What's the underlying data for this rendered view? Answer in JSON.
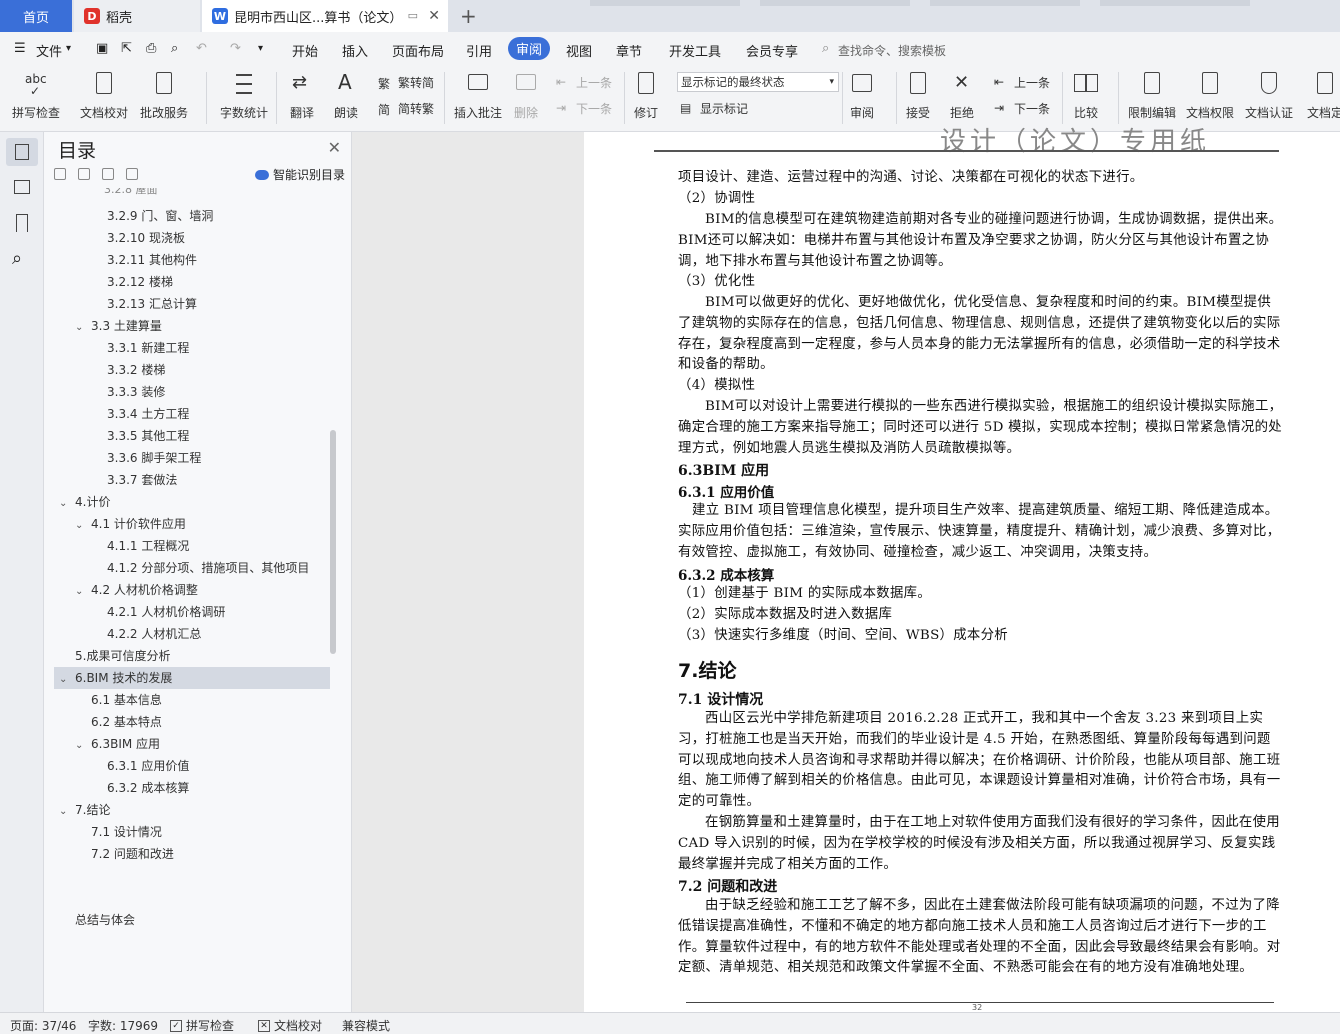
{
  "tabs": {
    "home": "首页",
    "daoke": "稻壳",
    "doc": "昆明市西山区...算书（论文）"
  },
  "menu": {
    "file": "文件",
    "items": [
      "开始",
      "插入",
      "页面布局",
      "引用",
      "审阅",
      "视图",
      "章节",
      "开发工具",
      "会员专享"
    ],
    "search": "查找命令、搜索模板"
  },
  "ribbon": {
    "spell": "拼写检查",
    "doccheck": "文档校对",
    "batch": "批改服务",
    "wordcount": "字数统计",
    "translate": "翻译",
    "read": "朗读",
    "trad": "繁转简",
    "simp": "简转繁",
    "insert_comment": "插入批注",
    "delete": "删除",
    "prev_comment": "上一条",
    "next_comment": "下一条",
    "track": "修订",
    "markup_state": "显示标记的最终状态",
    "show_markup": "显示标记",
    "review": "审阅",
    "accept": "接受",
    "reject": "拒绝",
    "prev": "上一条",
    "next": "下一条",
    "compare": "比较",
    "restrict": "限制编辑",
    "perm": "文档权限",
    "certify": "文档认证",
    "finalize": "文档定"
  },
  "toc": {
    "title": "目录",
    "smart": "智能识别目录",
    "items": [
      "3.2.9 门、窗、墙洞",
      "3.2.10 现浇板",
      "3.2.11 其他构件",
      "3.2.12 楼梯",
      "3.2.13 汇总计算",
      "3.3 土建算量",
      "3.3.1 新建工程",
      "3.3.2 楼梯",
      "3.3.3 装修",
      "3.3.4 土方工程",
      "3.3.5 其他工程",
      "3.3.6 脚手架工程",
      "3.3.7 套做法",
      "4.计价",
      "4.1 计价软件应用",
      "4.1.1 工程概况",
      "4.1.2 分部分项、措施项目、其他项目",
      "4.2 人材机价格调整",
      "4.2.1 人材机价格调研",
      "4.2.2 人材机汇总",
      "5.成果可信度分析",
      "6.BIM 技术的发展",
      "6.1 基本信息",
      "6.2 基本特点",
      "6.3BIM 应用",
      "6.3.1 应用价值",
      "6.3.2 成本核算",
      "7.结论",
      "7.1 设计情况",
      "7.2 问题和改进",
      "总结与体会"
    ]
  },
  "doc": {
    "header": "设计（论文）专用纸",
    "p1": "项目设计、建造、运营过程中的沟通、讨论、决策都在可视化的状态下进行。",
    "h_coord": "（2）协调性",
    "p2": "BIM的信息模型可在建筑物建造前期对各专业的碰撞问题进行协调，生成协调数据，提供出来。BIM还可以解决如：电梯井布置与其他设计布置及净空要求之协调，防火分区与其他设计布置之协调，地下排水布置与其他设计布置之协调等。",
    "h_opt": "（3）优化性",
    "p3": "BIM可以做更好的优化、更好地做优化，优化受信息、复杂程度和时间的约束。BIM模型提供了建筑物的实际存在的信息，包括几何信息、物理信息、规则信息，还提供了建筑物变化以后的实际存在，复杂程度高到一定程度，参与人员本身的能力无法掌握所有的信息，必须借助一定的科学技术和设备的帮助。",
    "h_sim": "（4）模拟性",
    "p4": "BIM可以对设计上需要进行模拟的一些东西进行模拟实验，根据施工的组织设计模拟实际施工，确定合理的施工方案来指导施工；同时还可以进行 5D 模拟，实现成本控制；模拟日常紧急情况的处理方式，例如地震人员逃生模拟及消防人员疏散模拟等。",
    "h63": "6.3BIM 应用",
    "h631": "6.3.1 应用价值",
    "p5": "建立 BIM 项目管理信息化模型，提升项目生产效率、提高建筑质量、缩短工期、降低建造成本。实际应用价值包括：三维渲染，宣传展示、快速算量，精度提升、精确计划，减少浪费、多算对比，有效管控、虚拟施工，有效协同、碰撞检查，减少返工、冲突调用，决策支持。",
    "h632": "6.3.2 成本核算",
    "l1": "（1）创建基于 BIM 的实际成本数据库。",
    "l2": "（2）实际成本数据及时进入数据库",
    "l3": "（3）快速实行多维度（时间、空间、WBS）成本分析",
    "h7": "7.结论",
    "h71": "7.1 设计情况",
    "p6": "西山区云光中学排危新建项目 2016.2.28 正式开工，我和其中一个舍友 3.23 来到项目上实习，打桩施工也是当天开始，而我们的毕业设计是 4.5 开始，在熟悉图纸、算量阶段每每遇到问题可以现成地向技术人员咨询和寻求帮助并得以解决；在价格调研、计价阶段，也能从项目部、施工班组、施工师傅了解到相关的价格信息。由此可见，本课题设计算量相对准确，计价符合市场，具有一定的可靠性。",
    "p7": "在钢筋算量和土建算量时，由于在工地上对软件使用方面我们没有很好的学习条件，因此在使用 CAD 导入识别的时候，因为在学校学校的时候没有涉及相关方面，所以我通过视屏学习、反复实践最终掌握并完成了相关方面的工作。",
    "h72": "7.2 问题和改进",
    "p8": "由于缺乏经验和施工工艺了解不多，因此在土建套做法阶段可能有缺项漏项的问题，不过为了降低错误提高准确性，不懂和不确定的地方都向施工技术人员和施工人员咨询过后才进行下一步的工作。算量软件过程中，有的地方软件不能处理或者处理的不全面，因此会导致最终结果会有影响。对定额、清单规范、相关规范和政策文件掌握不全面、不熟悉可能会在有的地方没有准确地处理。",
    "footer_num": "32"
  },
  "status": {
    "page": "页面: 37/46",
    "words": "字数: 17969",
    "spell": "拼写检查",
    "check": "文档校对",
    "compat": "兼容模式"
  },
  "colors": {
    "accent": "#3a6fd8",
    "selected": "#d4d9e2"
  }
}
